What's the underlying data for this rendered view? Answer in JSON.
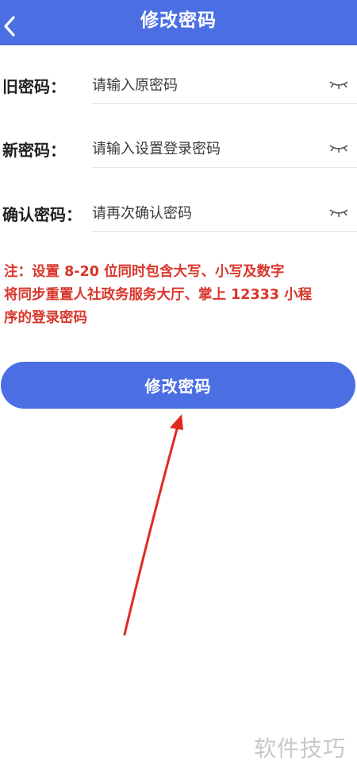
{
  "header": {
    "title": "修改密码"
  },
  "form": {
    "old_password": {
      "label": "旧密码：",
      "placeholder": "请输入原密码"
    },
    "new_password": {
      "label": "新密码：",
      "placeholder": "请输入设置登录密码"
    },
    "confirm_password": {
      "label": "确认密码：",
      "placeholder": "请再次确认密码"
    }
  },
  "note": {
    "line1": "注：设置 8-20 位同时包含大写、小写及数字",
    "line2": "将同步重置人社政务服务大厅、掌上 12333 小程",
    "line3": "序的登录密码"
  },
  "submit": {
    "label": "修改密码"
  },
  "watermark": {
    "text": "软件技巧"
  },
  "colors": {
    "primary": "#4b6fe3",
    "note": "#d9362b",
    "arrow": "#e02a20",
    "watermark": "#c8c8c8"
  },
  "icons": {
    "back": "chevron-left-icon",
    "eye_toggle": "eye-closed-icon"
  }
}
